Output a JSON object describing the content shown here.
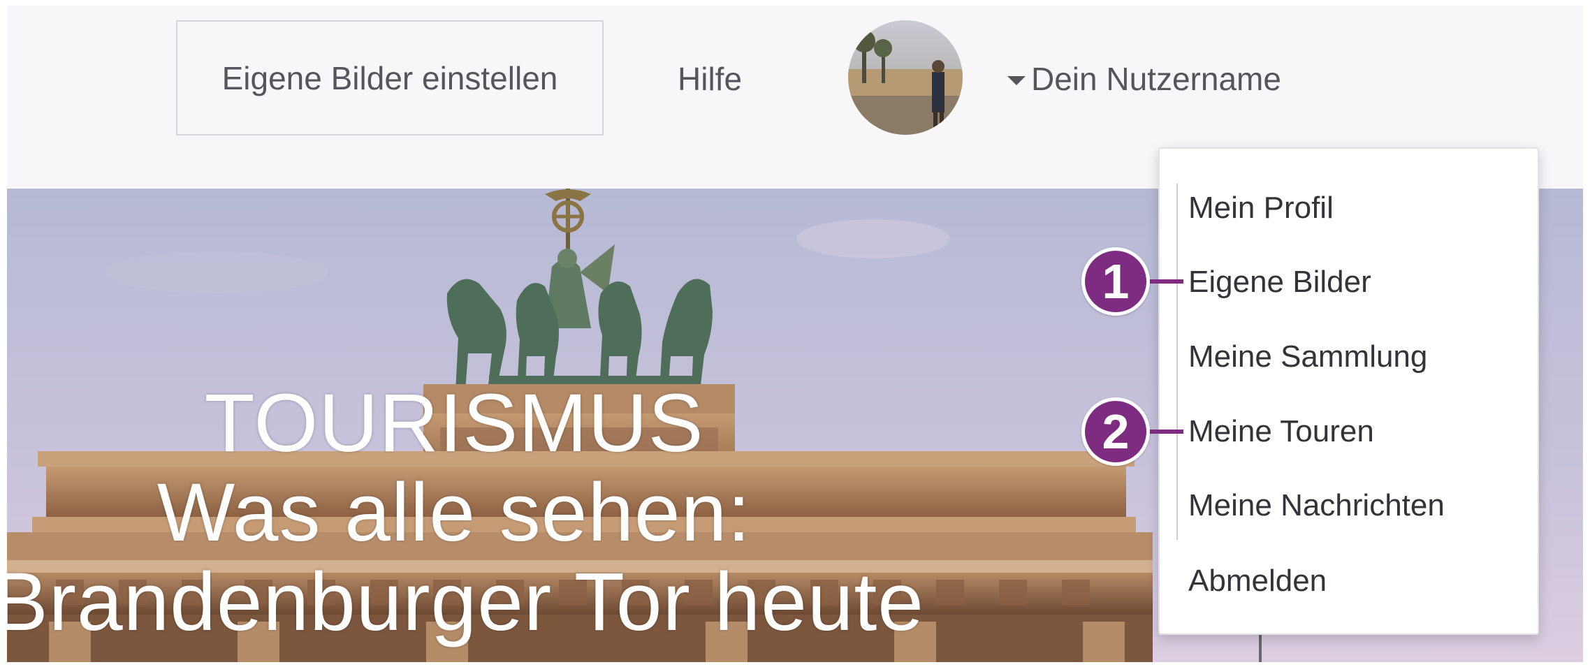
{
  "header": {
    "upload_button_label": "Eigene Bilder einstellen",
    "help_label": "Hilfe",
    "username": "Dein Nutzername"
  },
  "hero": {
    "title_lines": [
      "TOURISMUS",
      "Was alle sehen:",
      "Brandenburger Tor heute"
    ]
  },
  "user_menu": {
    "items": [
      {
        "label": "Mein Profil"
      },
      {
        "label": "Eigene Bilder"
      },
      {
        "label": "Meine Sammlung"
      },
      {
        "label": "Meine Touren"
      },
      {
        "label": "Meine Nachrichten"
      },
      {
        "label": "Abmelden"
      }
    ]
  },
  "callouts": [
    {
      "number": "1",
      "target": "Eigene Bilder"
    },
    {
      "number": "2",
      "target": "Meine Touren"
    }
  ],
  "colors": {
    "header_bg": "#f7f7f9",
    "callout": "#7e2b82",
    "text": "#55555c",
    "sky_top": "#b6b9d4",
    "sky_bottom": "#dccde0"
  }
}
